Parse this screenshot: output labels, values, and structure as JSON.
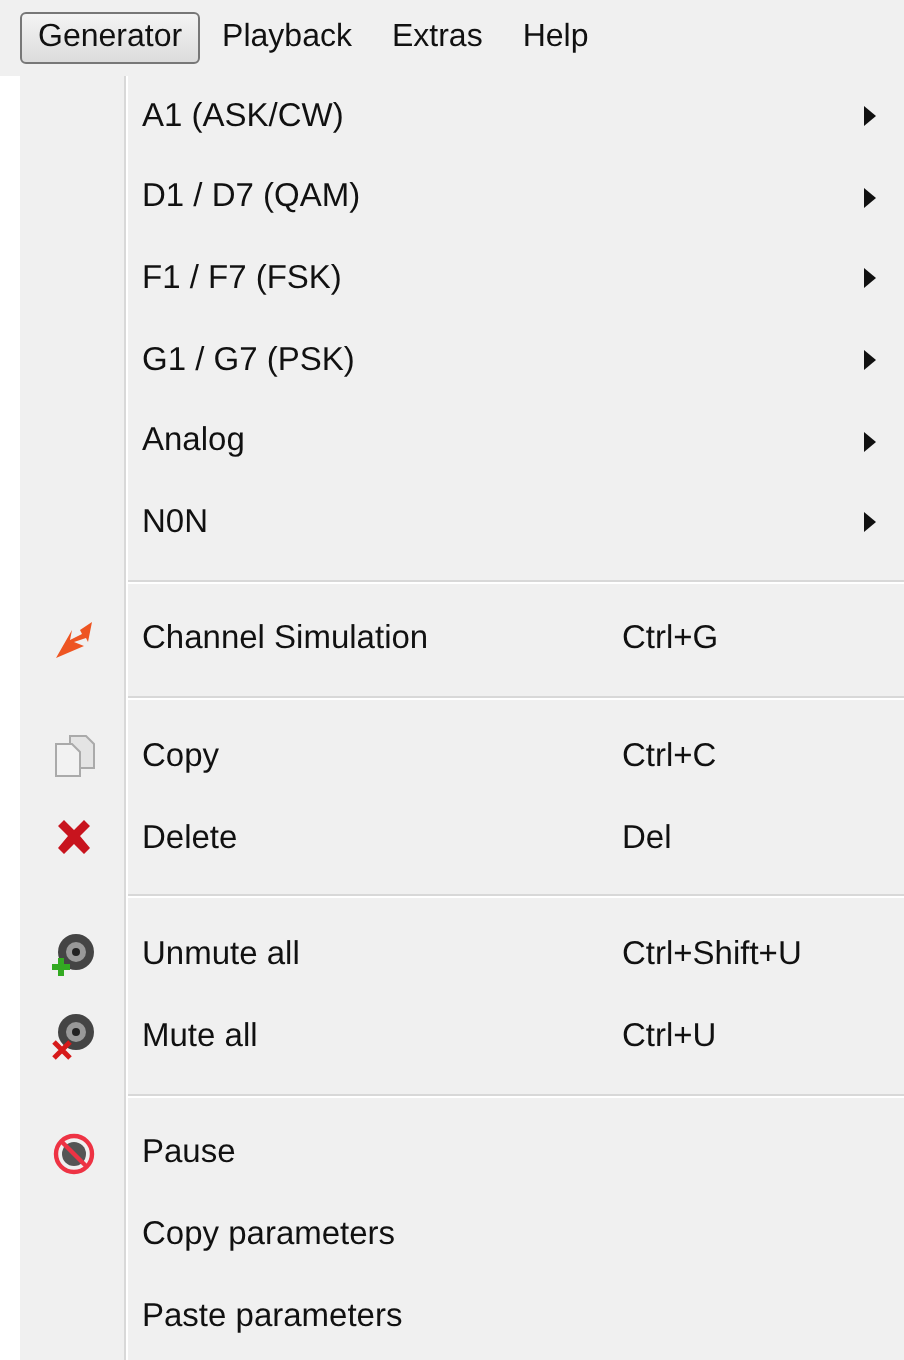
{
  "menubar": [
    {
      "label": "Generator",
      "selected": true
    },
    {
      "label": "Playback",
      "selected": false
    },
    {
      "label": "Extras",
      "selected": false
    },
    {
      "label": "Help",
      "selected": false
    }
  ],
  "menu": {
    "groups": [
      {
        "items": [
          {
            "label": "A1 (ASK/CW)",
            "submenu": true
          },
          {
            "label": "D1 / D7 (QAM)",
            "submenu": true
          },
          {
            "label": "F1 / F7 (FSK)",
            "submenu": true
          },
          {
            "label": "G1 / G7 (PSK)",
            "submenu": true
          },
          {
            "label": "Analog",
            "submenu": true
          },
          {
            "label": "N0N",
            "submenu": true
          }
        ]
      },
      {
        "items": [
          {
            "label": "Channel Simulation",
            "shortcut": "Ctrl+G"
          }
        ]
      },
      {
        "items": [
          {
            "label": "Copy",
            "shortcut": "Ctrl+C"
          },
          {
            "label": "Delete",
            "shortcut": "Del"
          }
        ]
      },
      {
        "items": [
          {
            "label": "Unmute all",
            "shortcut": "Ctrl+Shift+U"
          },
          {
            "label": "Mute all",
            "shortcut": "Ctrl+U"
          }
        ]
      },
      {
        "items": [
          {
            "label": "Pause"
          },
          {
            "label": "Copy parameters"
          },
          {
            "label": "Paste parameters"
          }
        ]
      }
    ]
  }
}
